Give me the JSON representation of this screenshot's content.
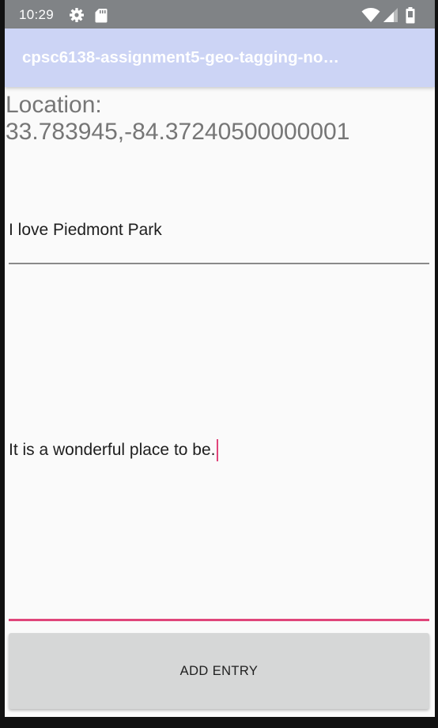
{
  "status_bar": {
    "time": "10:29",
    "icons": [
      "settings-gear-icon",
      "sd-card-icon",
      "wifi-icon",
      "cell-signal-icon",
      "battery-icon"
    ]
  },
  "app_bar": {
    "title": "cpsc6138-assignment5-geo-tagging-no…"
  },
  "location": {
    "text": "Location: 33.783945,-84.37240500000001"
  },
  "entry_title": {
    "value": "I love Piedmont Park"
  },
  "entry_body": {
    "value": "It is a wonderful place to be."
  },
  "add_button": {
    "label": "ADD ENTRY"
  },
  "colors": {
    "status_bar": "#808386",
    "app_bar": "#ccd4f5",
    "accent": "#e0457a",
    "button": "#d6d7d7",
    "background": "#fafafa"
  }
}
